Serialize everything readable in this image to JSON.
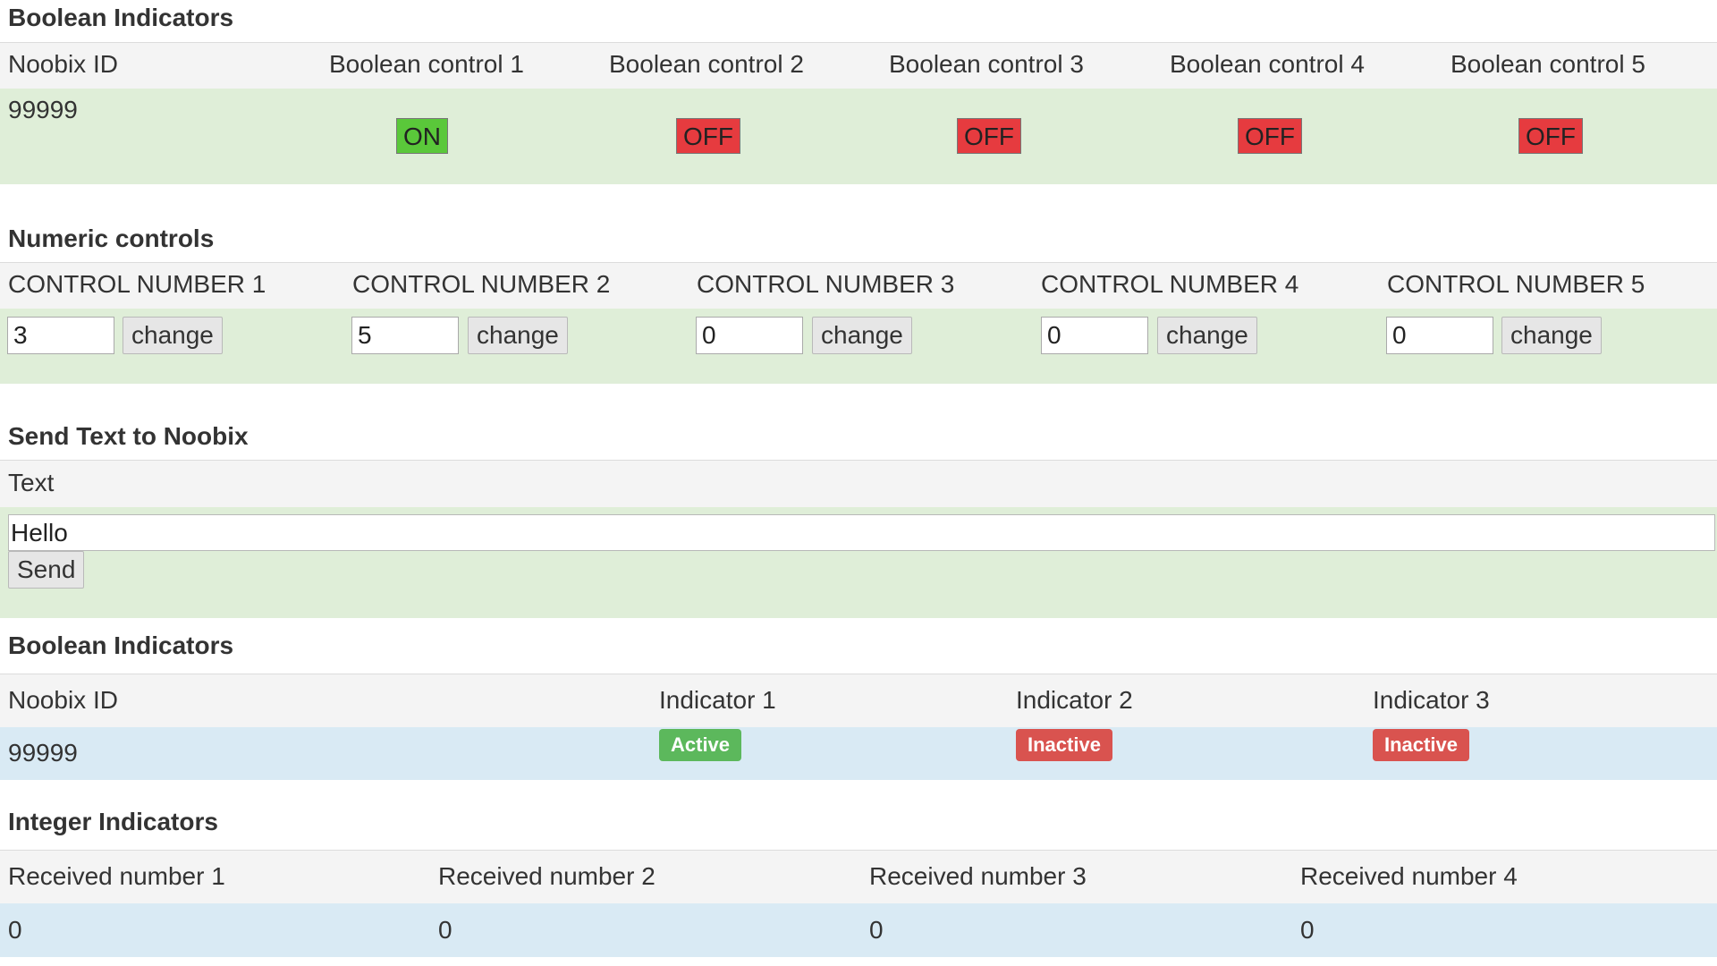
{
  "boolean_controls": {
    "title": "Boolean Indicators",
    "headers": [
      "Noobix ID",
      "Boolean control 1",
      "Boolean control 2",
      "Boolean control 3",
      "Boolean control 4",
      "Boolean control 5"
    ],
    "noobix_id": "99999",
    "toggles": [
      {
        "label": "ON",
        "state": "on"
      },
      {
        "label": "OFF",
        "state": "off"
      },
      {
        "label": "OFF",
        "state": "off"
      },
      {
        "label": "OFF",
        "state": "off"
      },
      {
        "label": "OFF",
        "state": "off"
      }
    ]
  },
  "numeric_controls": {
    "title": "Numeric controls",
    "headers": [
      "CONTROL NUMBER 1",
      "CONTROL NUMBER 2",
      "CONTROL NUMBER 3",
      "CONTROL NUMBER 4",
      "CONTROL NUMBER 5"
    ],
    "values": [
      "3",
      "5",
      "0",
      "0",
      "0"
    ],
    "button_label": "change"
  },
  "send_text": {
    "title": "Send Text to Noobix",
    "header": "Text",
    "value": "Hello",
    "button_label": "Send"
  },
  "boolean_indicators": {
    "title": "Boolean Indicators",
    "headers": [
      "Noobix ID",
      "Indicator 1",
      "Indicator 2",
      "Indicator 3"
    ],
    "noobix_id": "99999",
    "badges": [
      {
        "label": "Active",
        "state": "active"
      },
      {
        "label": "Inactive",
        "state": "inactive"
      },
      {
        "label": "Inactive",
        "state": "inactive"
      }
    ]
  },
  "integer_indicators": {
    "title": "Integer Indicators",
    "headers": [
      "Received number 1",
      "Received number 2",
      "Received number 3",
      "Received number 4"
    ],
    "values": [
      "0",
      "0",
      "0",
      "0"
    ]
  },
  "colors": {
    "on": "#5ac83a",
    "off": "#e63b3f",
    "active": "#5cb85c",
    "inactive": "#d9534f",
    "row_green": "#dfeed8",
    "row_blue": "#d9eaf4"
  }
}
